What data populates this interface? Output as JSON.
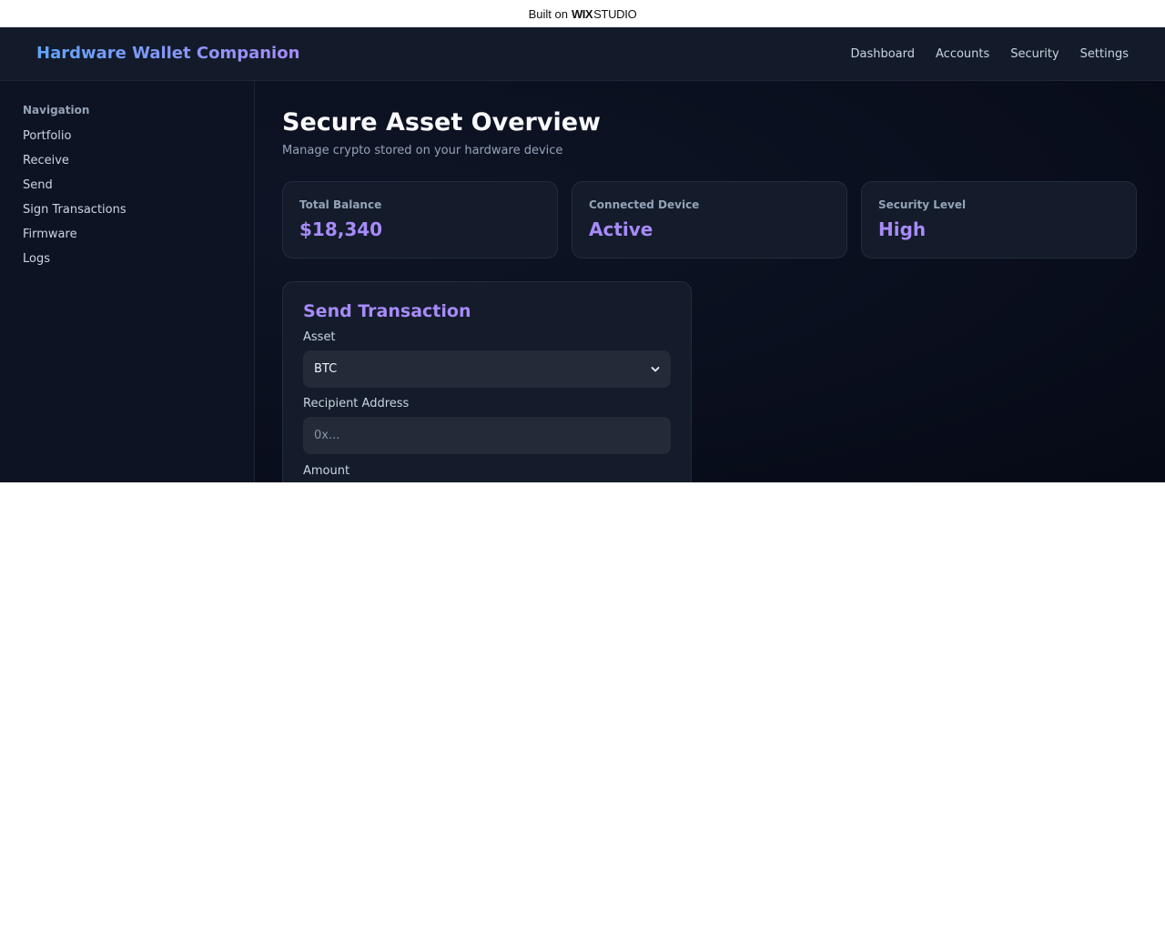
{
  "banner": {
    "built_on": "Built on",
    "wix": "WIX",
    "studio": "STUDIO"
  },
  "header": {
    "title": "Hardware Wallet Companion",
    "nav": [
      "Dashboard",
      "Accounts",
      "Security",
      "Settings"
    ]
  },
  "sidebar": {
    "title": "Navigation",
    "items": [
      "Portfolio",
      "Receive",
      "Send",
      "Sign Transactions",
      "Firmware",
      "Logs"
    ]
  },
  "main": {
    "title": "Secure Asset Overview",
    "subtitle": "Manage crypto stored on your hardware device",
    "cards": [
      {
        "label": "Total Balance",
        "value": "$18,340"
      },
      {
        "label": "Connected Device",
        "value": "Active"
      },
      {
        "label": "Security Level",
        "value": "High"
      }
    ]
  },
  "send_form": {
    "title": "Send Transaction",
    "asset_label": "Asset",
    "asset_value": "BTC",
    "recipient_label": "Recipient Address",
    "recipient_placeholder": "0x...",
    "amount_label": "Amount"
  },
  "colors": {
    "accent": "#a78bfa",
    "brand_gradient_start": "#60a5fa",
    "brand_gradient_end": "#a78bfa",
    "background": "#0a0f1e",
    "panel": "#141b2a"
  },
  "icons": {
    "select_chevron": "chevron-down-icon"
  }
}
